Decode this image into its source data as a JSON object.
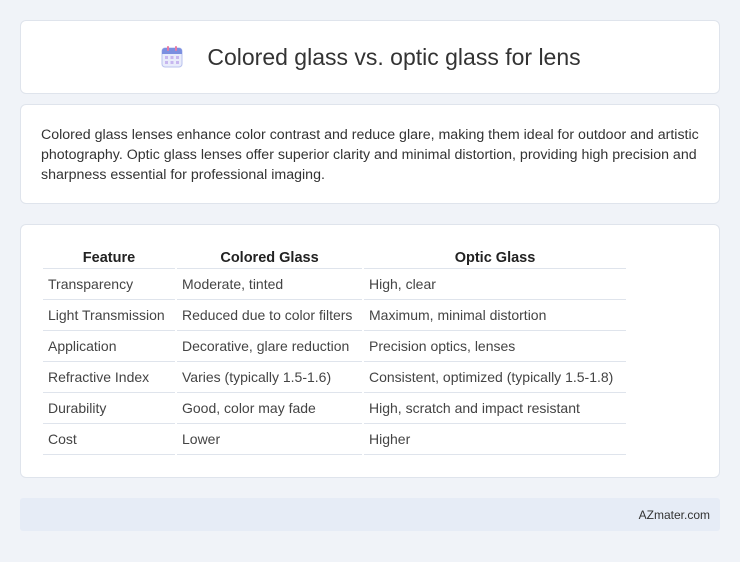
{
  "header": {
    "title": "Colored glass vs. optic glass for lens",
    "icon": "calendar-icon"
  },
  "summary": {
    "text": "Colored glass lenses enhance color contrast and reduce glare, making them ideal for outdoor and artistic photography. Optic glass lenses offer superior clarity and minimal distortion, providing high precision and sharpness essential for professional imaging."
  },
  "table": {
    "columns": [
      "Feature",
      "Colored Glass",
      "Optic Glass"
    ],
    "rows": [
      [
        "Transparency",
        "Moderate, tinted",
        "High, clear"
      ],
      [
        "Light Transmission",
        "Reduced due to color filters",
        "Maximum, minimal distortion"
      ],
      [
        "Application",
        "Decorative, glare reduction",
        "Precision optics, lenses"
      ],
      [
        "Refractive Index",
        "Varies (typically 1.5-1.6)",
        "Consistent, optimized (typically 1.5-1.8)"
      ],
      [
        "Durability",
        "Good, color may fade",
        "High, scratch and impact resistant"
      ],
      [
        "Cost",
        "Lower",
        "Higher"
      ]
    ]
  },
  "footer": {
    "brand": "AZmater.com"
  },
  "colors": {
    "background": "#f0f3f8",
    "card": "#ffffff",
    "footer": "#e6ecf6",
    "icon_accent": "#7b8fe0"
  }
}
